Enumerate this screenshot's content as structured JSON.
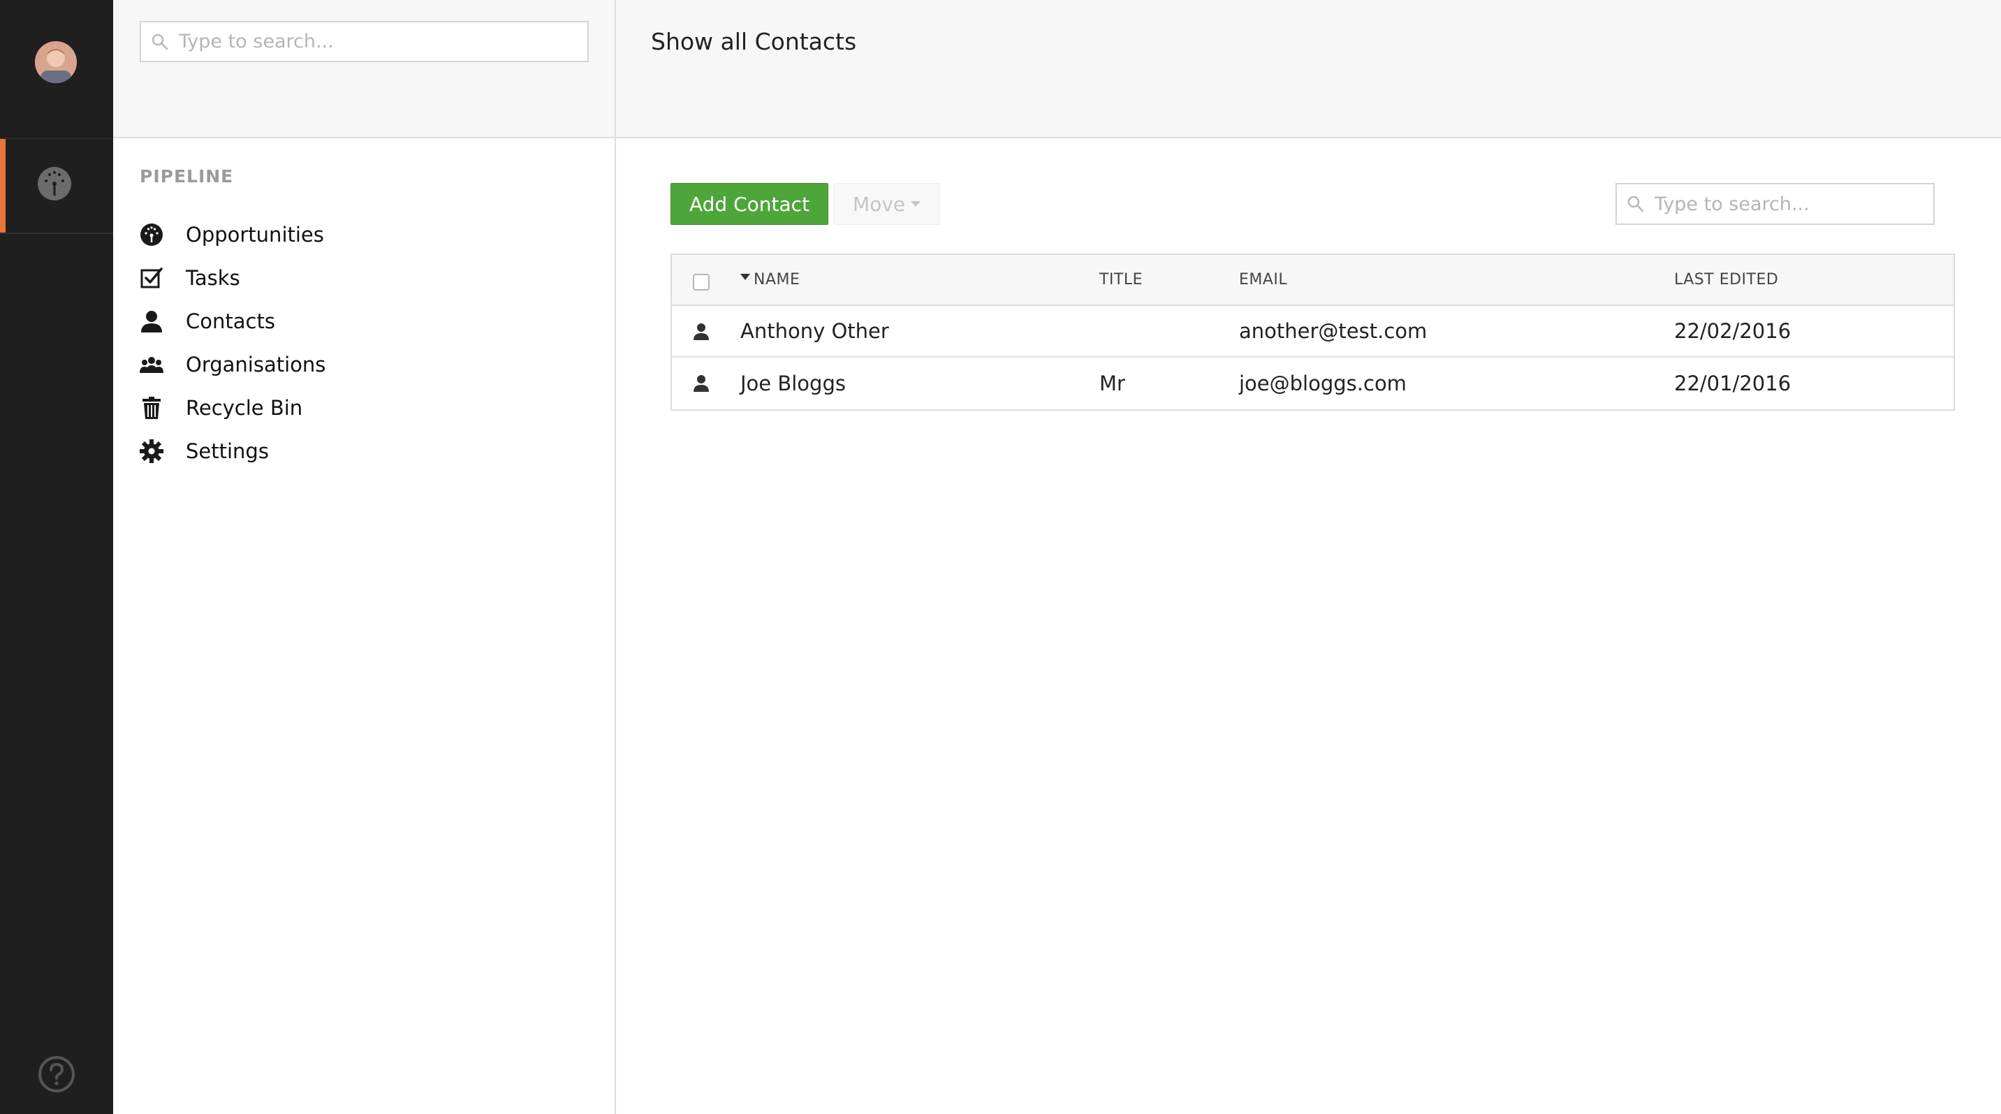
{
  "sidebar_search": {
    "placeholder": "Type to search..."
  },
  "rail": {
    "avatar": "user-avatar",
    "active": "dashboard-icon",
    "bottom": "help-icon",
    "accent_color": "#e8753b"
  },
  "nav": {
    "section_label": "PIPELINE",
    "items": [
      {
        "label": "Opportunities",
        "icon": "dashboard-icon"
      },
      {
        "label": "Tasks",
        "icon": "checkbox-icon"
      },
      {
        "label": "Contacts",
        "icon": "person-icon"
      },
      {
        "label": "Organisations",
        "icon": "group-icon"
      },
      {
        "label": "Recycle Bin",
        "icon": "trash-icon"
      },
      {
        "label": "Settings",
        "icon": "gear-icon"
      }
    ]
  },
  "main": {
    "title": "Show all Contacts",
    "add_label": "Add Contact",
    "add_color": "#4ea63a",
    "move_label": "Move",
    "search_placeholder": "Type to search..."
  },
  "table": {
    "columns": {
      "name": "NAME",
      "title": "TITLE",
      "email": "EMAIL",
      "edited": "LAST EDITED"
    },
    "sort_column": "name",
    "rows": [
      {
        "name": "Anthony Other",
        "title": "",
        "email": "another@test.com",
        "edited": "22/02/2016"
      },
      {
        "name": "Joe Bloggs",
        "title": "Mr",
        "email": "joe@bloggs.com",
        "edited": "22/01/2016"
      }
    ]
  }
}
